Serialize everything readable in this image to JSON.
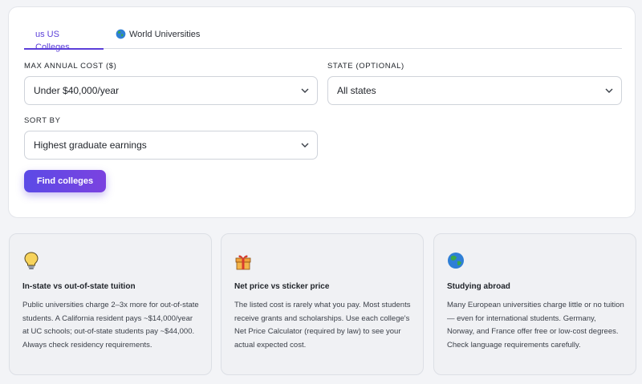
{
  "tabs": [
    {
      "label": "us US Colleges",
      "active": true
    },
    {
      "label": "World Universities",
      "icon": "globe-icon",
      "active": false
    }
  ],
  "filters": {
    "max_cost": {
      "label": "MAX ANNUAL COST ($)",
      "value": "Under $40,000/year"
    },
    "state": {
      "label": "STATE (OPTIONAL)",
      "value": "All states"
    },
    "sort": {
      "label": "SORT BY",
      "value": "Highest graduate earnings"
    }
  },
  "find_button": "Find colleges",
  "info_cards": [
    {
      "icon": "lightbulb-icon",
      "title": "In-state vs out-of-state tuition",
      "body": "Public universities charge 2–3x more for out-of-state students. A California resident pays ~$14,000/year at UC schools; out-of-state students pay ~$44,000. Always check residency requirements."
    },
    {
      "icon": "gift-icon",
      "title": "Net price vs sticker price",
      "body": "The listed cost is rarely what you pay. Most students receive grants and scholarships. Use each college's Net Price Calculator (required by law) to see your actual expected cost."
    },
    {
      "icon": "globe-icon",
      "title": "Studying abroad",
      "body": "Many European universities charge little or no tuition — even for international students. Germany, Norway, and France offer free or low-cost degrees. Check language requirements carefully."
    }
  ],
  "colors": {
    "accent": "#5b3fd9",
    "button_start": "#5b4ae6",
    "button_end": "#7b42e0"
  }
}
